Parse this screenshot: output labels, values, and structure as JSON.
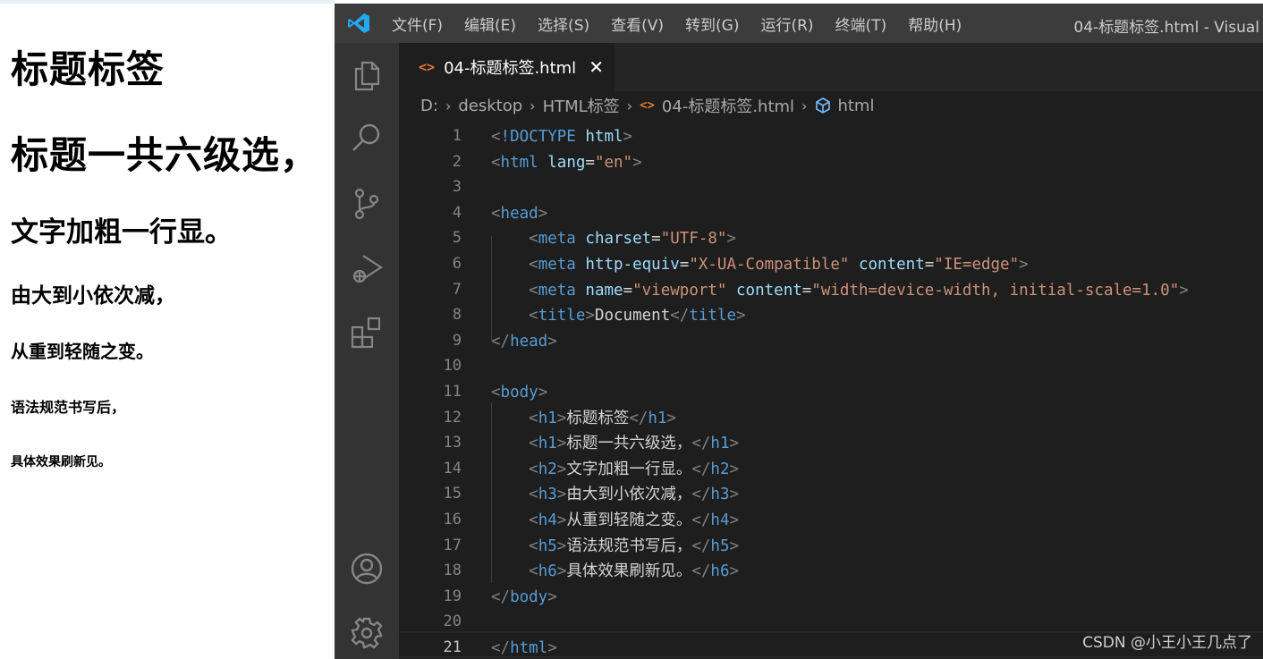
{
  "preview": {
    "headings": [
      {
        "level": "h1",
        "text": "标题标签"
      },
      {
        "level": "h1",
        "text": "标题一共六级选，"
      },
      {
        "level": "h2",
        "text": "文字加粗一行显。"
      },
      {
        "level": "h3",
        "text": "由大到小依次减，"
      },
      {
        "level": "h4",
        "text": "从重到轻随之变。"
      },
      {
        "level": "h5",
        "text": "语法规范书写后，"
      },
      {
        "level": "h6",
        "text": "具体效果刷新见。"
      }
    ]
  },
  "titlebar": {
    "menu": [
      "文件(F)",
      "编辑(E)",
      "选择(S)",
      "查看(V)",
      "转到(G)",
      "运行(R)",
      "终端(T)",
      "帮助(H)"
    ],
    "window_title": "04-标题标签.html - Visual"
  },
  "activity_bar": {
    "icons": [
      "files-icon",
      "search-icon",
      "source-control-icon",
      "run-debug-icon",
      "extensions-icon",
      "account-icon",
      "settings-gear-icon"
    ]
  },
  "tab": {
    "icon": "<>",
    "label": "04-标题标签.html",
    "close": "✕"
  },
  "breadcrumb": {
    "items": [
      "D:",
      "desktop",
      "HTML标签",
      "04-标题标签.html",
      "html"
    ]
  },
  "editor": {
    "active_line": 21,
    "lines": [
      {
        "n": "1",
        "t": [
          [
            "punc",
            "<"
          ],
          [
            "tag",
            "!DOCTYPE"
          ],
          [
            "text",
            " "
          ],
          [
            "attr",
            "html"
          ],
          [
            "punc",
            ">"
          ]
        ]
      },
      {
        "n": "2",
        "t": [
          [
            "punc",
            "<"
          ],
          [
            "tag",
            "html"
          ],
          [
            "text",
            " "
          ],
          [
            "attr",
            "lang"
          ],
          [
            "text",
            "="
          ],
          [
            "str",
            "\"en\""
          ],
          [
            "punc",
            ">"
          ]
        ]
      },
      {
        "n": "3",
        "t": []
      },
      {
        "n": "4",
        "t": [
          [
            "punc",
            "<"
          ],
          [
            "tag",
            "head"
          ],
          [
            "punc",
            ">"
          ]
        ]
      },
      {
        "n": "5",
        "t": [
          [
            "text",
            "    "
          ],
          [
            "punc",
            "<"
          ],
          [
            "tag",
            "meta"
          ],
          [
            "text",
            " "
          ],
          [
            "attr",
            "charset"
          ],
          [
            "text",
            "="
          ],
          [
            "str",
            "\"UTF-8\""
          ],
          [
            "punc",
            ">"
          ]
        ]
      },
      {
        "n": "6",
        "t": [
          [
            "text",
            "    "
          ],
          [
            "punc",
            "<"
          ],
          [
            "tag",
            "meta"
          ],
          [
            "text",
            " "
          ],
          [
            "attr",
            "http-equiv"
          ],
          [
            "text",
            "="
          ],
          [
            "str",
            "\"X-UA-Compatible\""
          ],
          [
            "text",
            " "
          ],
          [
            "attr",
            "content"
          ],
          [
            "text",
            "="
          ],
          [
            "str",
            "\"IE=edge\""
          ],
          [
            "punc",
            ">"
          ]
        ]
      },
      {
        "n": "7",
        "t": [
          [
            "text",
            "    "
          ],
          [
            "punc",
            "<"
          ],
          [
            "tag",
            "meta"
          ],
          [
            "text",
            " "
          ],
          [
            "attr",
            "name"
          ],
          [
            "text",
            "="
          ],
          [
            "str",
            "\"viewport\""
          ],
          [
            "text",
            " "
          ],
          [
            "attr",
            "content"
          ],
          [
            "text",
            "="
          ],
          [
            "str",
            "\"width=device-width, initial-scale=1.0\""
          ],
          [
            "punc",
            ">"
          ]
        ]
      },
      {
        "n": "8",
        "t": [
          [
            "text",
            "    "
          ],
          [
            "punc",
            "<"
          ],
          [
            "tag",
            "title"
          ],
          [
            "punc",
            ">"
          ],
          [
            "text",
            "Document"
          ],
          [
            "punc",
            "</"
          ],
          [
            "tag",
            "title"
          ],
          [
            "punc",
            ">"
          ]
        ]
      },
      {
        "n": "9",
        "t": [
          [
            "punc",
            "</"
          ],
          [
            "tag",
            "head"
          ],
          [
            "punc",
            ">"
          ]
        ]
      },
      {
        "n": "10",
        "t": []
      },
      {
        "n": "11",
        "t": [
          [
            "punc",
            "<"
          ],
          [
            "tag",
            "body"
          ],
          [
            "punc",
            ">"
          ]
        ]
      },
      {
        "n": "12",
        "t": [
          [
            "text",
            "    "
          ],
          [
            "punc",
            "<"
          ],
          [
            "tag",
            "h1"
          ],
          [
            "punc",
            ">"
          ],
          [
            "zh",
            "标题标签"
          ],
          [
            "punc",
            "</"
          ],
          [
            "tag",
            "h1"
          ],
          [
            "punc",
            ">"
          ]
        ]
      },
      {
        "n": "13",
        "t": [
          [
            "text",
            "    "
          ],
          [
            "punc",
            "<"
          ],
          [
            "tag",
            "h1"
          ],
          [
            "punc",
            ">"
          ],
          [
            "zh",
            "标题一共六级选，"
          ],
          [
            "punc",
            "</"
          ],
          [
            "tag",
            "h1"
          ],
          [
            "punc",
            ">"
          ]
        ]
      },
      {
        "n": "14",
        "t": [
          [
            "text",
            "    "
          ],
          [
            "punc",
            "<"
          ],
          [
            "tag",
            "h2"
          ],
          [
            "punc",
            ">"
          ],
          [
            "zh",
            "文字加粗一行显。"
          ],
          [
            "punc",
            "</"
          ],
          [
            "tag",
            "h2"
          ],
          [
            "punc",
            ">"
          ]
        ]
      },
      {
        "n": "15",
        "t": [
          [
            "text",
            "    "
          ],
          [
            "punc",
            "<"
          ],
          [
            "tag",
            "h3"
          ],
          [
            "punc",
            ">"
          ],
          [
            "zh",
            "由大到小依次减，"
          ],
          [
            "punc",
            "</"
          ],
          [
            "tag",
            "h3"
          ],
          [
            "punc",
            ">"
          ]
        ]
      },
      {
        "n": "16",
        "t": [
          [
            "text",
            "    "
          ],
          [
            "punc",
            "<"
          ],
          [
            "tag",
            "h4"
          ],
          [
            "punc",
            ">"
          ],
          [
            "zh",
            "从重到轻随之变。"
          ],
          [
            "punc",
            "</"
          ],
          [
            "tag",
            "h4"
          ],
          [
            "punc",
            ">"
          ]
        ]
      },
      {
        "n": "17",
        "t": [
          [
            "text",
            "    "
          ],
          [
            "punc",
            "<"
          ],
          [
            "tag",
            "h5"
          ],
          [
            "punc",
            ">"
          ],
          [
            "zh",
            "语法规范书写后，"
          ],
          [
            "punc",
            "</"
          ],
          [
            "tag",
            "h5"
          ],
          [
            "punc",
            ">"
          ]
        ]
      },
      {
        "n": "18",
        "t": [
          [
            "text",
            "    "
          ],
          [
            "punc",
            "<"
          ],
          [
            "tag",
            "h6"
          ],
          [
            "punc",
            ">"
          ],
          [
            "zh",
            "具体效果刷新见。"
          ],
          [
            "punc",
            "</"
          ],
          [
            "tag",
            "h6"
          ],
          [
            "punc",
            ">"
          ]
        ]
      },
      {
        "n": "19",
        "t": [
          [
            "punc",
            "</"
          ],
          [
            "tag",
            "body"
          ],
          [
            "punc",
            ">"
          ]
        ]
      },
      {
        "n": "20",
        "t": []
      },
      {
        "n": "21",
        "t": [
          [
            "punc",
            "</"
          ],
          [
            "tag",
            "html"
          ],
          [
            "punc",
            ">"
          ]
        ]
      }
    ]
  },
  "colors": {
    "editor_bg": "#1e1e1e",
    "tag": "#569cd6",
    "attribute": "#9cdcfe",
    "string": "#ce9178",
    "punctuation": "#808080",
    "html_file_icon": "#e37933",
    "vscode_blue": "#23a9f2"
  },
  "watermark": "CSDN @小王小王几点了"
}
